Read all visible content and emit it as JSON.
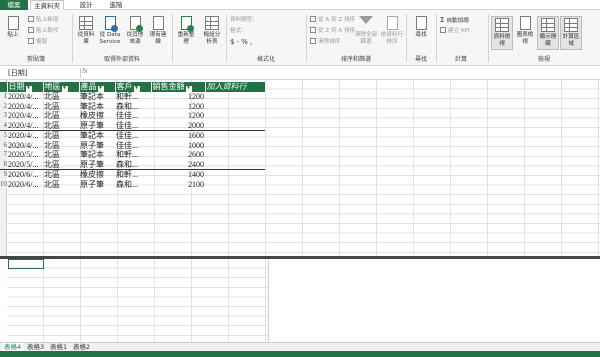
{
  "tabs": [
    "檔案",
    "主資料夾",
    "設計",
    "進階"
  ],
  "active_tab_index": 1,
  "ribbon": {
    "clipboard": {
      "group_label": "剪貼簿",
      "paste_label": "貼上",
      "paste_append_label": "貼上新增",
      "paste_replace_label": "貼上取代",
      "copy_label": "複製"
    },
    "external": {
      "group_label": "取得外部資料",
      "from_db_label": "從資料庫",
      "from_service_label": "從 Data Service",
      "from_other_label": "從其他來源",
      "existing_label": "現有連線"
    },
    "refresh_label": "重新整理",
    "pivot_label": "樞紐分析表",
    "format": {
      "group_label": "格式化",
      "datatype_label": "資料類型：",
      "format_label": "格式：",
      "currency_symbols": "$ · % ,"
    },
    "sort": {
      "group_label": "排序和篩選",
      "sort_az_label": "從 A 到 Z 排序",
      "sort_za_label": "從 Z 到 A 排序",
      "clear_sort_label": "清除排序",
      "clear_filters_label": "清除全部篩選",
      "sort_by_col_label": "依資料行排序"
    },
    "find": {
      "group_label": "尋找",
      "find_label": "尋找"
    },
    "calc": {
      "group_label": "計算",
      "autosum_label": "自動加總",
      "kpi_label": "建立 KPI"
    },
    "view": {
      "group_label": "檢視",
      "data_view_label": "資料檢視",
      "diagram_view_label": "圖表檢視",
      "show_hidden_label": "顯示隱藏",
      "calc_area_label": "計算區域"
    }
  },
  "formula_bar": {
    "name_box": "[日期]",
    "fx": "fx"
  },
  "table": {
    "headers": [
      "日期",
      "地區",
      "產品",
      "客戶",
      "銷售金額"
    ],
    "add_column_label": "加入資料行",
    "rows": [
      [
        "1",
        "2020/4/...",
        "北區",
        "筆記本",
        "和軒...",
        "1200"
      ],
      [
        "2",
        "2020/4/...",
        "北區",
        "筆記本",
        "森和...",
        "1200"
      ],
      [
        "3",
        "2020/4/...",
        "北區",
        "橡皮擦",
        "佳佳...",
        "1200"
      ],
      [
        "4",
        "2020/4/...",
        "北區",
        "原子筆",
        "佳佳...",
        "2000"
      ],
      [
        "5",
        "2020/4/...",
        "北區",
        "筆記本",
        "佳佳...",
        "1600"
      ],
      [
        "6",
        "2020/4/...",
        "北區",
        "原子筆",
        "佳佳...",
        "1000"
      ],
      [
        "7",
        "2020/5/...",
        "北區",
        "筆記本",
        "和軒...",
        "2600"
      ],
      [
        "8",
        "2020/5/...",
        "北區",
        "原子筆",
        "森和...",
        "2400"
      ],
      [
        "9",
        "2020/6/...",
        "北區",
        "橡皮擦",
        "和軒...",
        "1400"
      ],
      [
        "10",
        "2020/6/...",
        "北區",
        "原子筆",
        "森和...",
        "2100"
      ]
    ]
  },
  "sheet_tabs": [
    "表格4",
    "表格3",
    "表格1",
    "表格2"
  ],
  "active_sheet_index": 0,
  "colors": {
    "accent": "#217346"
  }
}
